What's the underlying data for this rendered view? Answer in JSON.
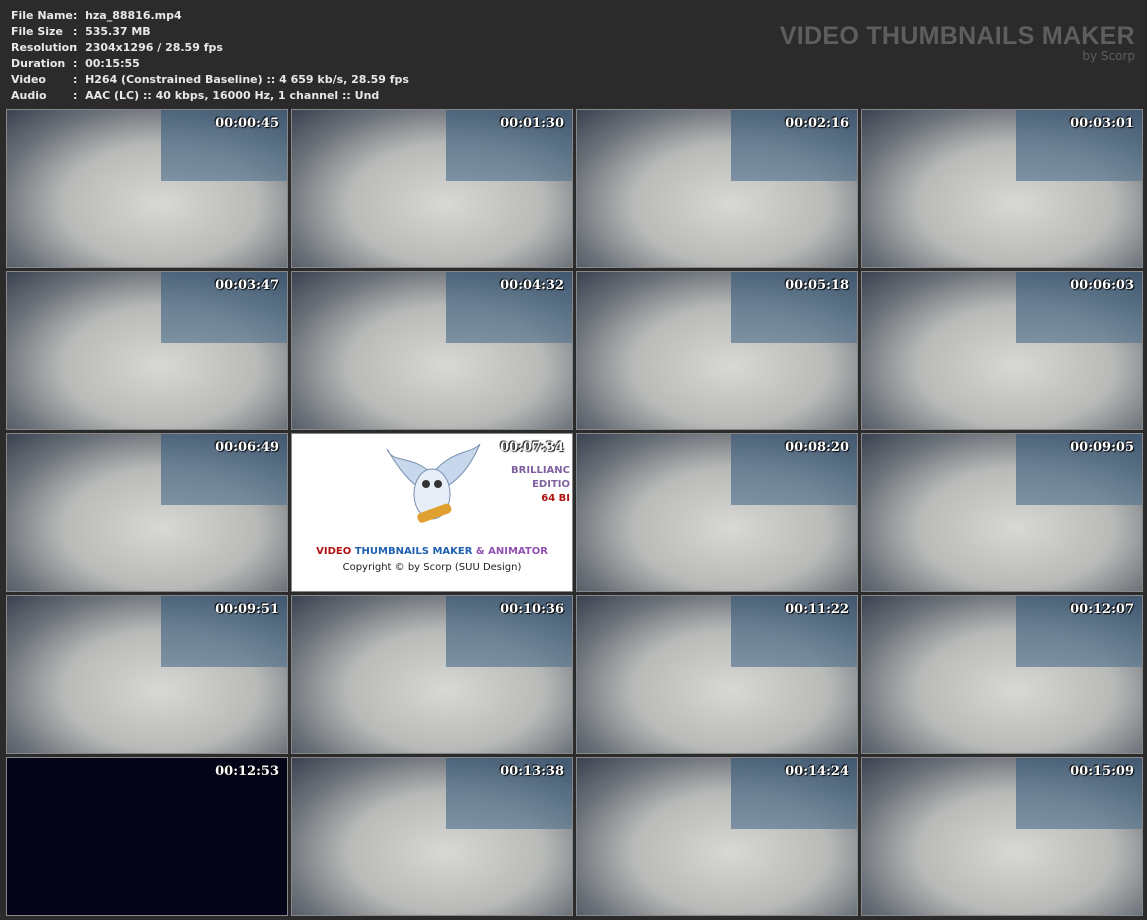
{
  "info": [
    {
      "label": "File Name",
      "value": "hza_88816.mp4"
    },
    {
      "label": "File Size",
      "value": "535.37 MB"
    },
    {
      "label": "Resolution",
      "value": "2304x1296 / 28.59 fps"
    },
    {
      "label": "Duration",
      "value": "00:15:55"
    },
    {
      "label": "Video",
      "value": "H264 (Constrained Baseline) :: 4 659 kb/s, 28.59 fps"
    },
    {
      "label": "Audio",
      "value": "AAC (LC) :: 40 kbps, 16000 Hz, 1 channel :: Und"
    }
  ],
  "brand": {
    "title": "VIDEO THUMBNAILS MAKER",
    "sub": "by Scorp"
  },
  "thumbnails": [
    "00:00:45",
    "00:01:30",
    "00:02:16",
    "00:03:01",
    "00:03:47",
    "00:04:32",
    "00:05:18",
    "00:06:03",
    "00:06:49",
    "00:07:34",
    "00:08:20",
    "00:09:05",
    "00:09:51",
    "00:10:36",
    "00:11:22",
    "00:12:07",
    "00:12:53",
    "00:13:38",
    "00:14:24",
    "00:15:09"
  ],
  "logo": {
    "t1": "VIDEO",
    "t2": "THUMBNAILS MAKER",
    "t3": "& ANIMATOR",
    "copy": "Copyright © by Scorp (SUU Design)",
    "ed1": "BRILLIANC",
    "ed2": "EDITIO",
    "ed3": "64 BI"
  }
}
